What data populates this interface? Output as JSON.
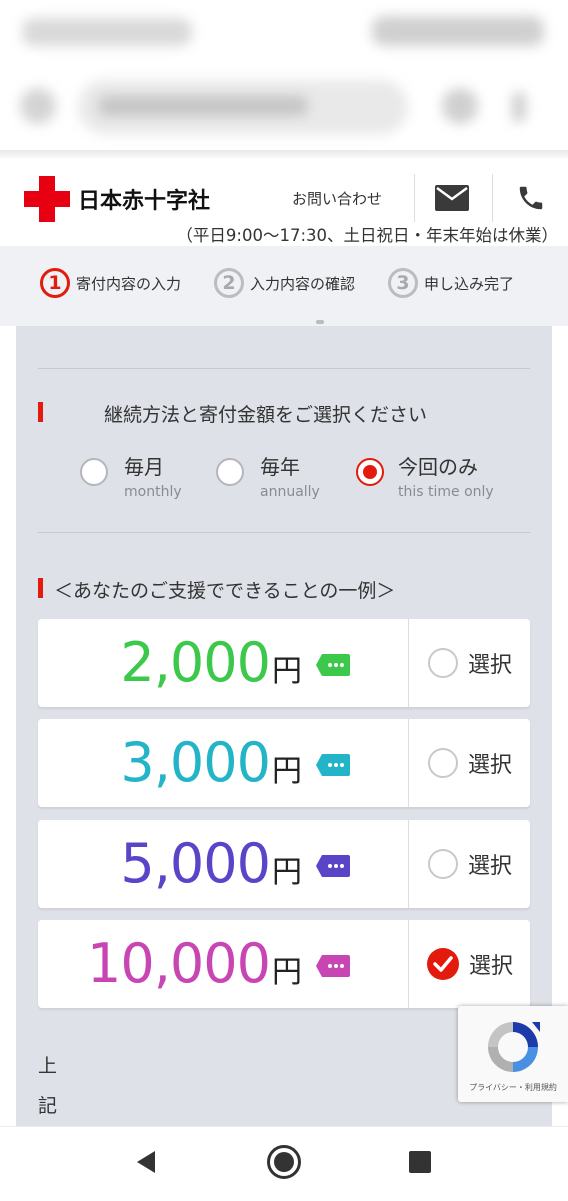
{
  "header": {
    "logo_text": "日本赤十字社",
    "contact_label": "お問い合わせ",
    "hours": "（平日9:00〜17:30、土日祝日・年末年始は休業）"
  },
  "steps": [
    {
      "num": "1",
      "label": "寄付内容の入力",
      "active": true
    },
    {
      "num": "2",
      "label": "入力内容の確認",
      "active": false
    },
    {
      "num": "3",
      "label": "申し込み完了",
      "active": false
    }
  ],
  "frequency": {
    "title": "継続方法と寄付金額をご選択ください",
    "options": [
      {
        "label": "毎月",
        "sub": "monthly",
        "selected": false
      },
      {
        "label": "毎年",
        "sub": "annually",
        "selected": false
      },
      {
        "label": "今回のみ",
        "sub": "this time only",
        "selected": true
      }
    ]
  },
  "examples": {
    "title": "＜あなたのご支援でできることの一例＞",
    "amounts": [
      {
        "value": "2,000",
        "unit": "円",
        "color": "#3cc84b",
        "select_label": "選択",
        "selected": false
      },
      {
        "value": "3,000",
        "unit": "円",
        "color": "#24b4c8",
        "select_label": "選択",
        "selected": false
      },
      {
        "value": "5,000",
        "unit": "円",
        "color": "#5a44c8",
        "select_label": "選択",
        "selected": false
      },
      {
        "value": "10,000",
        "unit": "円",
        "color": "#c846b4",
        "select_label": "選択",
        "selected": true
      }
    ]
  },
  "vertical_text": [
    "上",
    "記"
  ],
  "recaptcha": {
    "text": "プライバシー・利用規約"
  },
  "colors": {
    "accent": "#e21b0c"
  }
}
